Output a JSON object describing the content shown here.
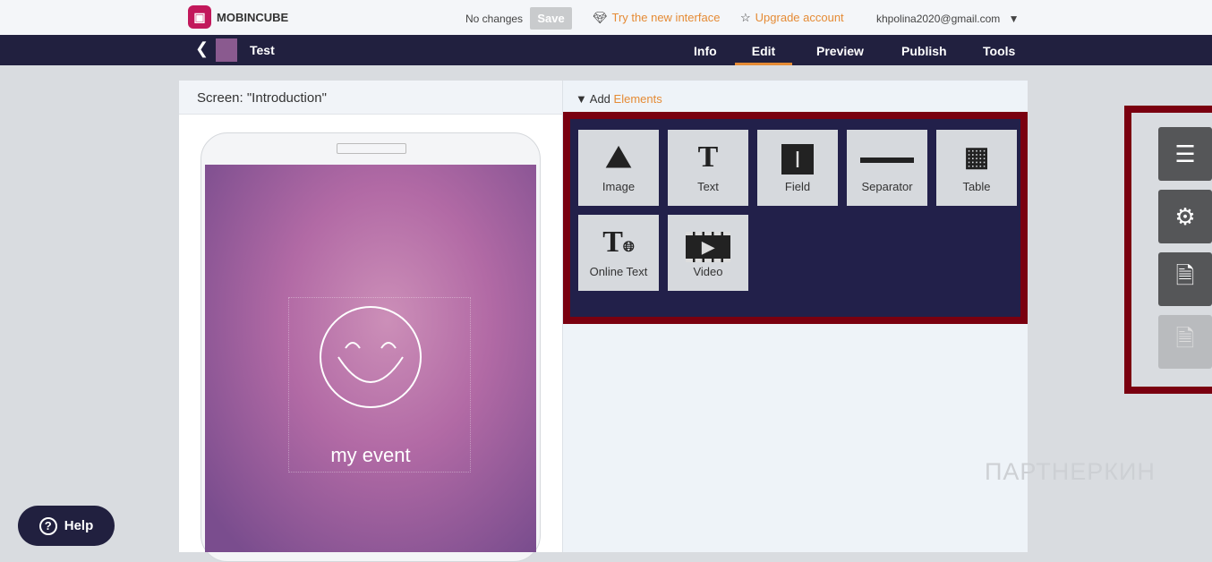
{
  "header": {
    "brand": "MOBINCUBE",
    "status": "No changes",
    "save_label": "Save",
    "try_label": "Try the new interface",
    "upgrade_label": "Upgrade account",
    "email": "khpolina2020@gmail.com"
  },
  "nav": {
    "app_title": "Test",
    "tabs": [
      "Info",
      "Edit",
      "Preview",
      "Publish",
      "Tools"
    ],
    "active_tab": "Edit"
  },
  "screen": {
    "title": "Screen: \"Introduction\"",
    "event_text": "my event"
  },
  "elements": {
    "add_label": "Add",
    "elements_label": "Elements",
    "tiles": [
      "Image",
      "Text",
      "Field",
      "Separator",
      "Table",
      "Online Text",
      "Video"
    ]
  },
  "help": {
    "label": "Help"
  },
  "watermark": "ПАРТНЕРКИН"
}
